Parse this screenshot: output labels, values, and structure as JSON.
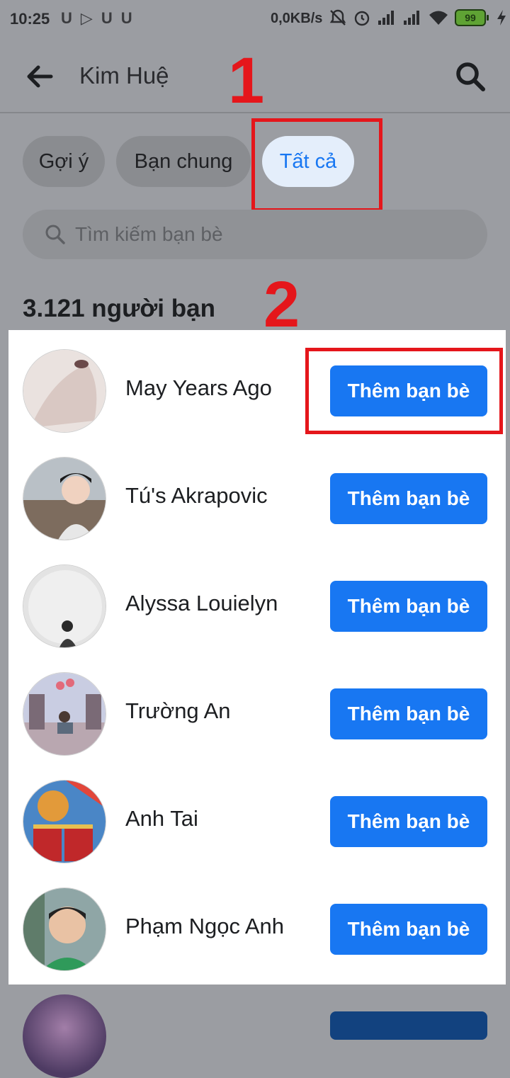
{
  "status_bar": {
    "time": "10:25",
    "left_icons": [
      "U",
      "▷",
      "U",
      "U"
    ],
    "net_speed": "0,0KB/s",
    "battery": "99"
  },
  "header": {
    "title": "Kim Huệ",
    "back_icon": "arrow-left-icon",
    "search_icon": "search-icon"
  },
  "annotations": {
    "step1": "1",
    "step2": "2",
    "color": "#e5161b"
  },
  "chips": [
    {
      "label": "Gợi ý",
      "active": false
    },
    {
      "label": "Bạn chung",
      "active": false
    },
    {
      "label": "Tất cả",
      "active": true
    }
  ],
  "friend_search": {
    "placeholder": "Tìm kiếm bạn bè"
  },
  "friend_count": "3.121 người bạn",
  "friends": [
    {
      "name": "May Years Ago",
      "button": "Thêm bạn bè"
    },
    {
      "name": "Tú's Akrapovic",
      "button": "Thêm bạn bè"
    },
    {
      "name": "Alyssa Louielyn",
      "button": "Thêm bạn bè"
    },
    {
      "name": "Trường An",
      "button": "Thêm bạn bè"
    },
    {
      "name": "Anh Tai",
      "button": "Thêm bạn bè"
    },
    {
      "name": "Phạm Ngọc Anh",
      "button": "Thêm bạn bè"
    }
  ],
  "colors": {
    "accent": "#1877f2",
    "overlay": "#9b9da2",
    "chip_active_bg": "#e4eefb"
  }
}
